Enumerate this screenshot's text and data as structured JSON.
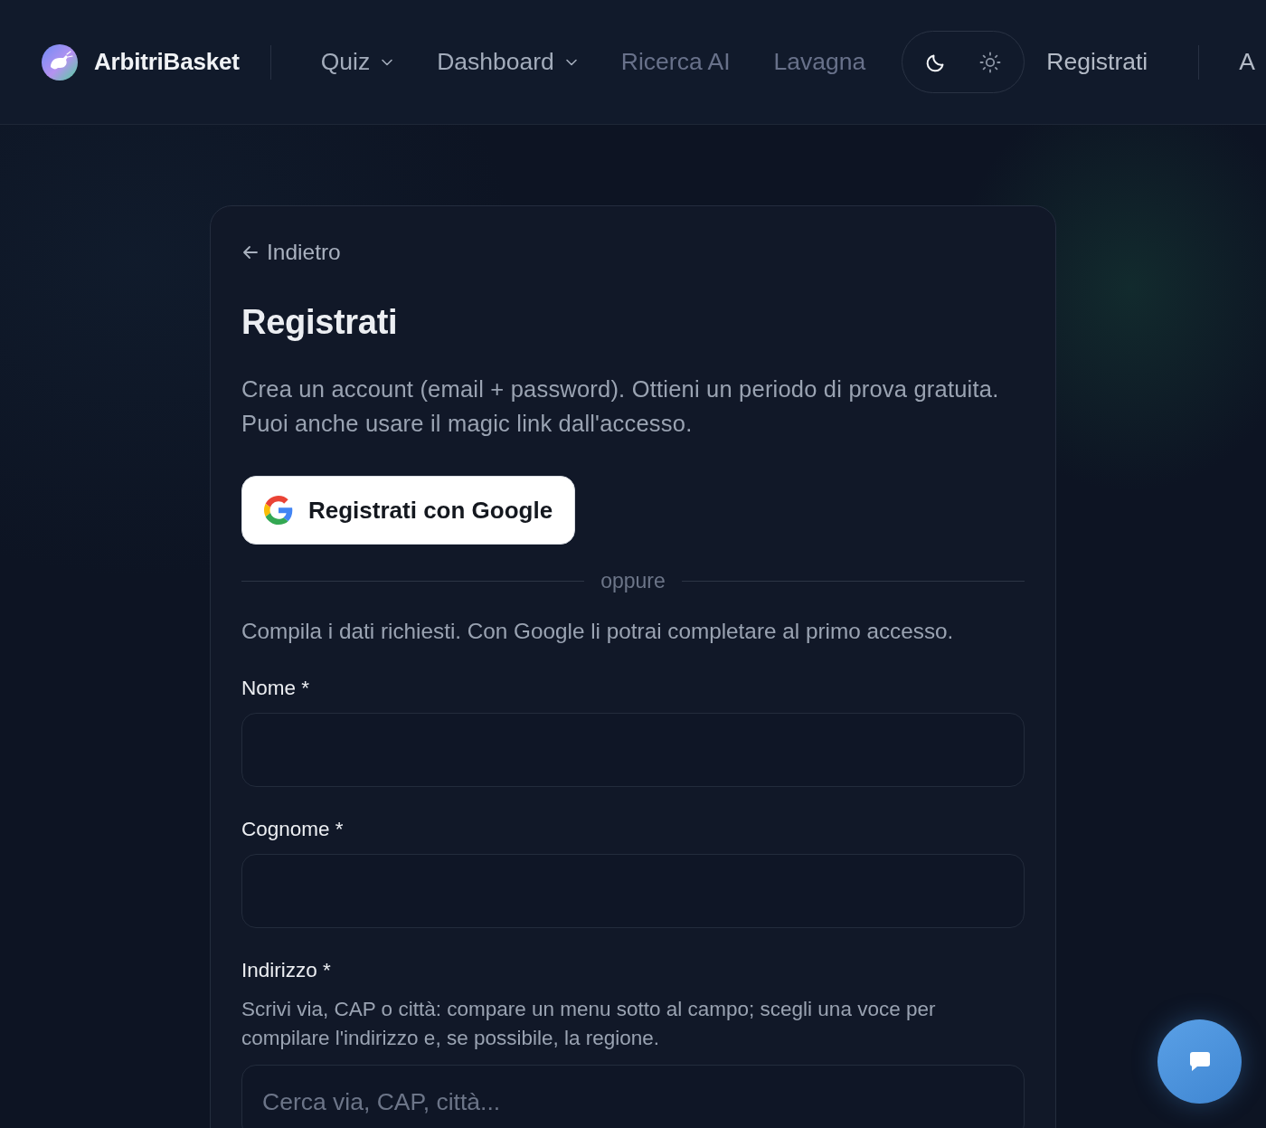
{
  "header": {
    "brand": "ArbitriBasket",
    "nav": [
      {
        "label": "Quiz",
        "kind": "dropdown",
        "disabled": false
      },
      {
        "label": "Dashboard",
        "kind": "dropdown",
        "disabled": false
      },
      {
        "label": "Ricerca AI",
        "kind": "link",
        "disabled": true
      },
      {
        "label": "Lavagna",
        "kind": "link",
        "disabled": true
      }
    ],
    "theme_toggle": [
      {
        "kind": "moon",
        "selected": true
      },
      {
        "kind": "sun",
        "selected": false
      }
    ],
    "register_link": "Registrati",
    "cut_link": "A"
  },
  "card": {
    "back_link": "Indietro",
    "title": "Registrati",
    "intro": "Crea un account (email + password). Ottieni un periodo di prova gratuita. Puoi anche usare il magic link dall'accesso.",
    "google_button": "Registrati con Google",
    "divider": "oppure",
    "note": "Compila i dati richiesti. Con Google li potrai completare al primo accesso.",
    "fields": [
      {
        "label": "Nome *"
      },
      {
        "label": "Cognome *"
      },
      {
        "label": "Indirizzo *",
        "help": "Scrivi via, CAP o città: compare un menu sotto al campo; scegli una voce per compilare l'indirizzo e, se possibile, la regione.",
        "placeholder": "Cerca via, CAP, città..."
      }
    ]
  }
}
